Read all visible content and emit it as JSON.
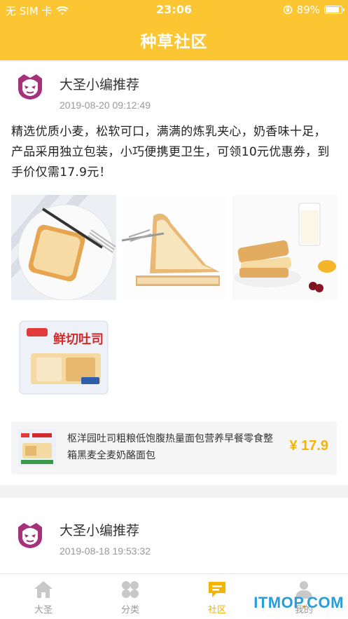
{
  "status_bar": {
    "carrier": "无 SIM 卡",
    "time": "23:06",
    "battery": "89%",
    "battery_level": 0.89
  },
  "header": {
    "title": "种草社区"
  },
  "posts": [
    {
      "author": "大圣小编推荐",
      "date": "2019-08-20 09:12:49",
      "text": "精选优质小麦，松软可口，满满的炼乳夹心，奶香味十足，产品采用独立包装，小巧便携更卫生，可领10元优惠券，到手价仅需17.9元！",
      "product": {
        "name": "枢洋园吐司粗粮低饱腹热量面包营养早餐零食整箱黑麦全麦奶酪面包",
        "price": "¥ 17.9",
        "package_text": "鲜切吐司"
      }
    },
    {
      "author": "大圣小编推荐",
      "date": "2019-08-18 19:53:32"
    }
  ],
  "tabs": [
    {
      "label": "大圣",
      "icon": "home-icon"
    },
    {
      "label": "分类",
      "icon": "category-icon"
    },
    {
      "label": "社区",
      "icon": "community-icon",
      "active": true
    },
    {
      "label": "我的",
      "icon": "profile-icon"
    }
  ],
  "watermark": {
    "prefix": "ITMOP",
    "dot": ".",
    "suffix": "COM"
  },
  "colors": {
    "accent": "#fcc532",
    "price": "#f5b400",
    "avatar": "#a6307a"
  }
}
